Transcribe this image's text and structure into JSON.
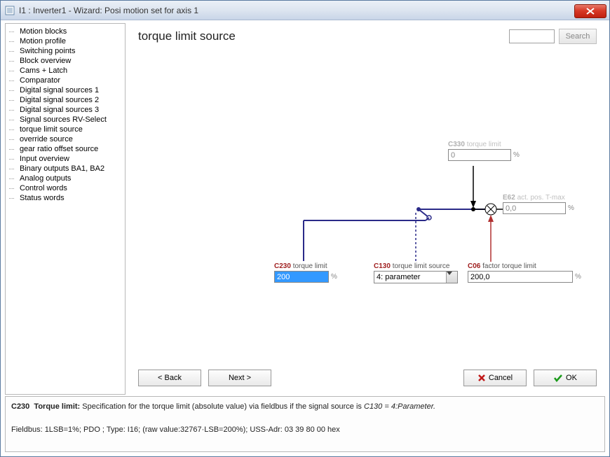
{
  "window": {
    "title": "I1 : Inverter1 - Wizard: Posi motion set for axis 1"
  },
  "sidebar": {
    "items": [
      "Motion blocks",
      "Motion profile",
      "Switching points",
      "Block overview",
      "Cams + Latch",
      "Comparator",
      "Digital signal sources 1",
      "Digital signal sources 2",
      "Digital signal sources 3",
      "Signal sources RV-Select",
      "torque limit source",
      "override source",
      "gear ratio offset source",
      "Input overview",
      "Binary outputs BA1, BA2",
      "Analog outputs",
      "Control words",
      "Status words"
    ],
    "selected_index": 10
  },
  "main": {
    "title": "torque limit source",
    "search_placeholder": "",
    "search_btn": "Search",
    "params": {
      "c330": {
        "code": "C330",
        "desc": "torque limit",
        "value": "0",
        "unit": "%"
      },
      "e62": {
        "code": "E62",
        "desc": "act. pos. T-max",
        "value": "0,0",
        "unit": "%"
      },
      "c230": {
        "code": "C230",
        "desc": "torque limit",
        "value": "200",
        "unit": "%"
      },
      "c130": {
        "code": "C130",
        "desc": "torque limit source",
        "value": "4: parameter"
      },
      "c06": {
        "code": "C06",
        "desc": "factor torque limit",
        "value": "200,0",
        "unit": "%"
      }
    },
    "nav": {
      "back": "< Back",
      "next": "Next >",
      "cancel": "Cancel",
      "ok": "OK"
    }
  },
  "info": {
    "line1_code": "C230",
    "line1_name": "Torque limit:",
    "line1_text": "Specification for the torque limit (absolute value) via fieldbus if the signal source is ",
    "line1_ref": "C130 = 4:Parameter.",
    "line2": "Fieldbus: 1LSB=1%; PDO ; Type: I16; (raw value:32767·LSB=200%); USS-Adr: 03 39 80 00 hex"
  }
}
